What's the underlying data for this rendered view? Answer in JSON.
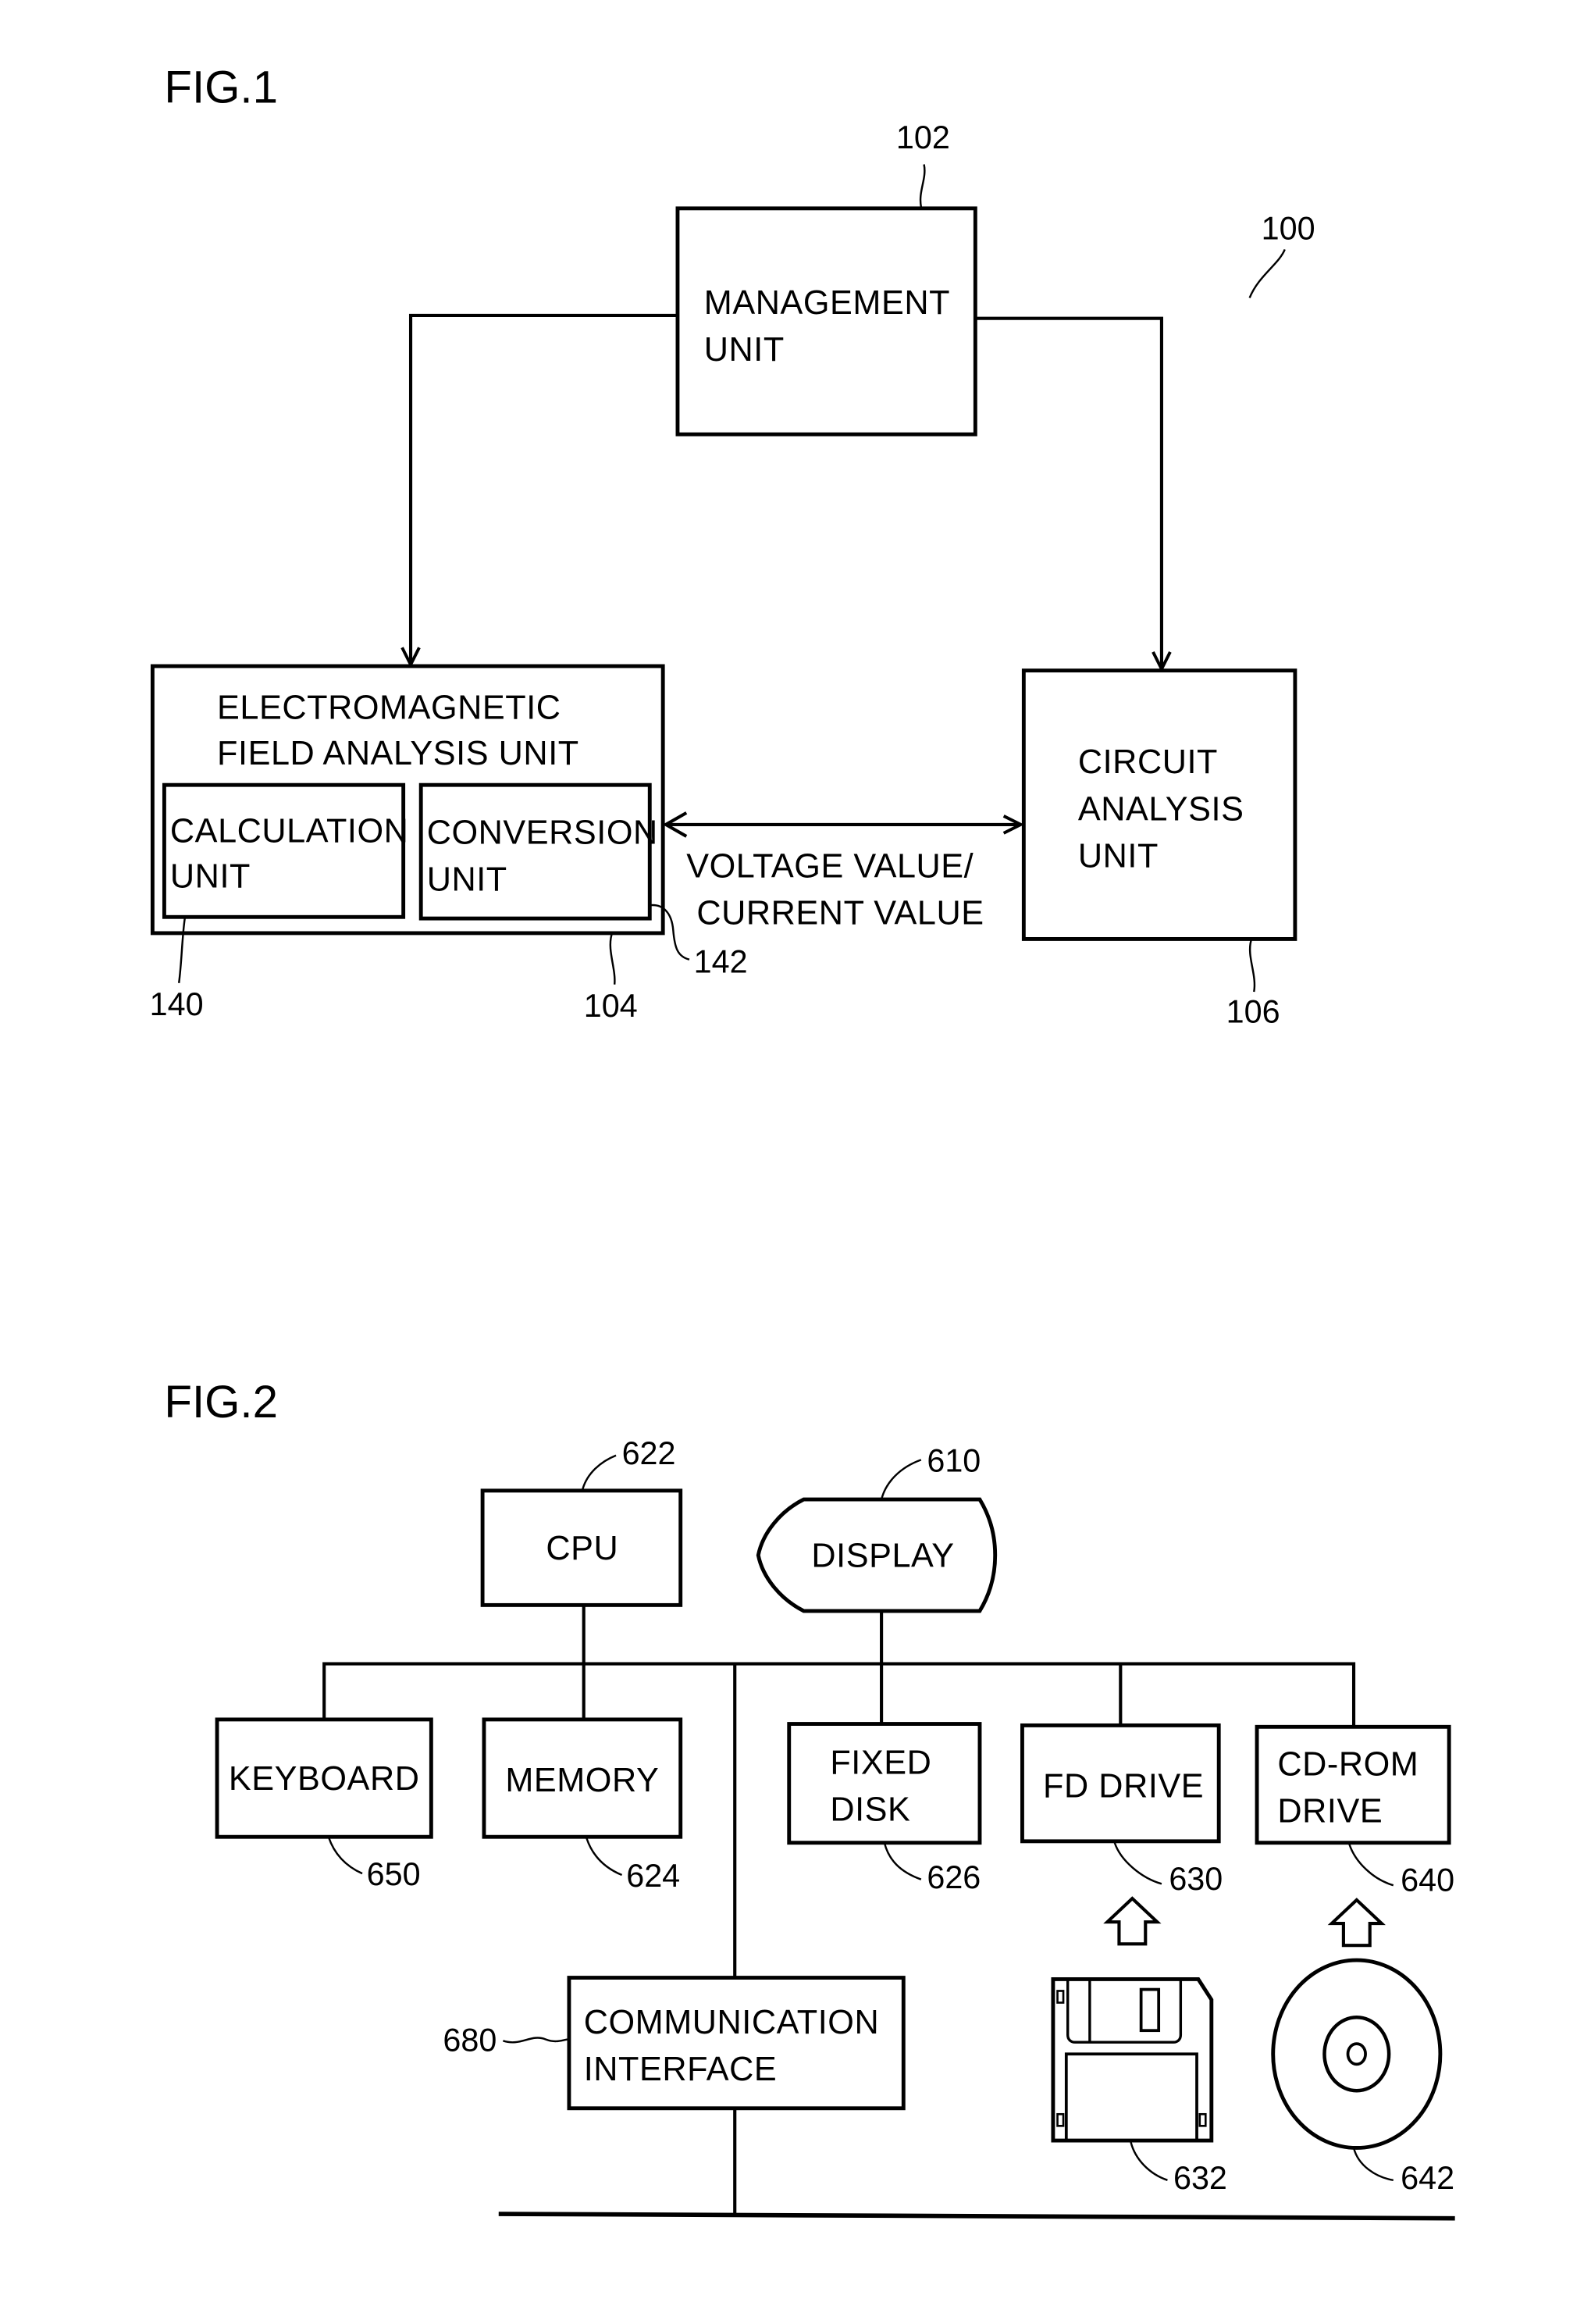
{
  "fig1": {
    "title": "FIG.1",
    "system_ref": "100",
    "management": {
      "ref": "102",
      "lines": [
        "MANAGEMENT",
        "UNIT"
      ]
    },
    "em_unit": {
      "ref": "104",
      "lines": [
        "ELECTROMAGNETIC",
        "FIELD ANALYSIS UNIT"
      ]
    },
    "calculation": {
      "ref": "140",
      "lines": [
        "CALCULATION",
        "UNIT"
      ]
    },
    "conversion": {
      "ref": "142",
      "lines": [
        "CONVERSION",
        "UNIT"
      ]
    },
    "circuit": {
      "ref": "106",
      "lines": [
        "CIRCUIT",
        "ANALYSIS",
        "UNIT"
      ]
    },
    "exchange_label": [
      "VOLTAGE VALUE/",
      "CURRENT VALUE"
    ]
  },
  "fig2": {
    "title": "FIG.2",
    "cpu": {
      "ref": "622",
      "label": "CPU"
    },
    "display": {
      "ref": "610",
      "label": "DISPLAY"
    },
    "keyboard": {
      "ref": "650",
      "label": "KEYBOARD"
    },
    "memory": {
      "ref": "624",
      "label": "MEMORY"
    },
    "fixed_disk": {
      "ref": "626",
      "lines": [
        "FIXED",
        "DISK"
      ]
    },
    "fd_drive": {
      "ref": "630",
      "label": "FD DRIVE"
    },
    "cdrom_drive": {
      "ref": "640",
      "lines": [
        "CD-ROM",
        "DRIVE"
      ]
    },
    "comm_interface": {
      "ref": "680",
      "lines": [
        "COMMUNICATION",
        "INTERFACE"
      ]
    },
    "floppy_disk": {
      "ref": "632",
      "icon": "floppy-disk-icon"
    },
    "cd_rom": {
      "ref": "642",
      "icon": "cd-disc-icon"
    }
  }
}
